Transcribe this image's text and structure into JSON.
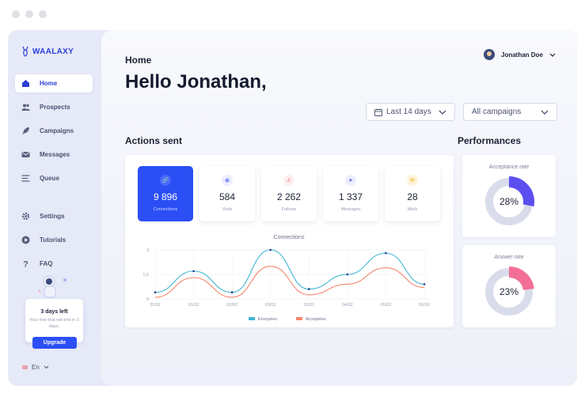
{
  "window": {
    "dots": 3
  },
  "brand": {
    "name": "WAALAXY"
  },
  "nav": {
    "items": [
      {
        "label": "Home",
        "icon": "home-icon",
        "active": true
      },
      {
        "label": "Prospects",
        "icon": "users-icon",
        "active": false
      },
      {
        "label": "Campaigns",
        "icon": "rocket-icon",
        "active": false
      },
      {
        "label": "Messages",
        "icon": "envelope-icon",
        "active": false
      },
      {
        "label": "Queue",
        "icon": "queue-icon",
        "active": false
      },
      {
        "label": "Settings",
        "icon": "gear-icon",
        "active": false
      },
      {
        "label": "Tutorials",
        "icon": "play-icon",
        "active": false
      },
      {
        "label": "FAQ",
        "icon": "question-icon",
        "active": false
      }
    ]
  },
  "trial": {
    "title": "3 days left",
    "text": "Your free trial will end in 3 days.",
    "button": "Upgrade"
  },
  "language": {
    "current": "En"
  },
  "header": {
    "breadcrumb": "Home",
    "greeting": "Hello Jonathan,",
    "user_name": "Jonathan Doe"
  },
  "filters": {
    "period": "Last 14 days",
    "campaigns": "All campaigns"
  },
  "actions": {
    "title": "Actions sent",
    "stats": [
      {
        "value": "9 896",
        "label": "Connections",
        "icon": "link-icon",
        "active": true,
        "icon_color": "#ffffff",
        "icon_bg": "#4a68ff"
      },
      {
        "value": "584",
        "label": "Visits",
        "icon": "eye-icon",
        "active": false,
        "icon_color": "#6f7cf0",
        "icon_bg": "#eceeff"
      },
      {
        "value": "2 262",
        "label": "Follows",
        "icon": "user-icon",
        "active": false,
        "icon_color": "#f07a8a",
        "icon_bg": "#ffeef0"
      },
      {
        "value": "1 337",
        "label": "Messages",
        "icon": "send-icon",
        "active": false,
        "icon_color": "#5b6bd8",
        "icon_bg": "#eceeff"
      },
      {
        "value": "28",
        "label": "Mails",
        "icon": "mail-icon",
        "active": false,
        "icon_color": "#f3a712",
        "icon_bg": "#fff4dc"
      }
    ]
  },
  "chart_data": {
    "type": "line",
    "title": "Connections",
    "x": [
      "31/01",
      "01/02",
      "02/02",
      "03/02",
      "31/01",
      "04/02",
      "05/02",
      "06/02"
    ],
    "yticks": [
      "3",
      "1,5",
      "0"
    ],
    "ylim": [
      0,
      3
    ],
    "series": [
      {
        "name": "Envoyées",
        "color": "#3eb6d2",
        "values": [
          0.4,
          1.7,
          0.4,
          3.0,
          0.6,
          1.5,
          2.8,
          0.9
        ]
      },
      {
        "name": "Acceptées",
        "color": "#f4866e",
        "values": [
          0.1,
          1.3,
          0.1,
          2.0,
          0.25,
          0.9,
          1.9,
          0.7
        ]
      }
    ],
    "legend": "bottom"
  },
  "performances": {
    "title": "Performances",
    "cards": [
      {
        "label": "Acceptance rate",
        "value": "28%",
        "fraction": 0.28,
        "color": "#5b4ff0"
      },
      {
        "label": "Answer rate",
        "value": "23%",
        "fraction": 0.23,
        "color": "#f36f98"
      }
    ]
  }
}
